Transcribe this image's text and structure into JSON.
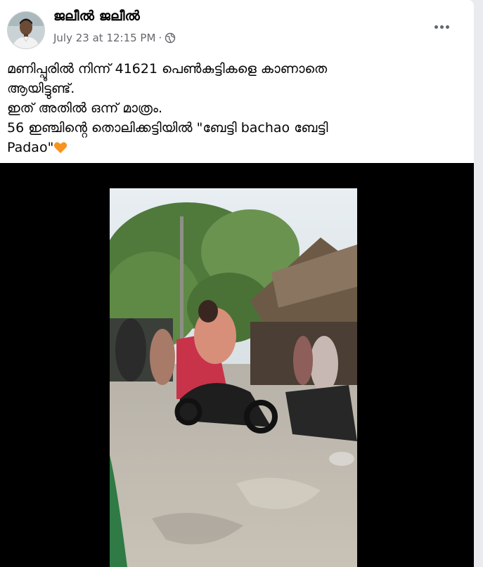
{
  "post": {
    "author": "ജലീൽ ജലീൽ",
    "date": "July 23 at 12:15 PM",
    "separator": "·",
    "more_icon": "more-horizontal-icon",
    "privacy_icon": "globe-icon",
    "text_lines": [
      "മണിപ്പൂരിൽ നിന്ന് 41621 പെൺകുട്ടികളെ കാണാതെ",
      "ആയിട്ടുണ്ട്.",
      "ഇത് അതിൽ ഒന്ന് മാത്രം.",
      "56 ഇഞ്ചിൻ്റെ തൊലിക്കട്ടിയിൽ  \"ബേട്ടി bachao ബേട്ടി",
      "Padao\""
    ],
    "emoji": "orange-heart-icon"
  },
  "video": {
    "description_icon": "video-frame"
  },
  "colors": {
    "card": "#ffffff",
    "text": "#050505",
    "meta": "#65676b",
    "heart": "#f7931e"
  }
}
